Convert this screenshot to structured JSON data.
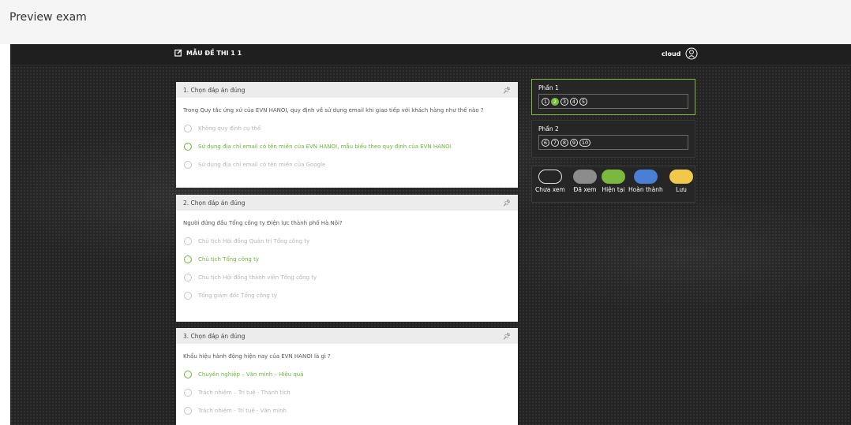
{
  "page": {
    "title": "Preview exam"
  },
  "exam": {
    "title": "MẪU ĐỀ THI 1 1",
    "user": "cloud"
  },
  "questions": [
    {
      "header": "1. Chọn đáp án đúng",
      "text": "Trong Quy tắc ứng xử của EVN HANOI, quy định về sử dụng email khi giao tiếp với khách hàng như thế nào ?",
      "options": [
        {
          "label": "Không quy định cụ thể",
          "selected": false
        },
        {
          "label": "Sử dụng địa chỉ email có tên miền của EVN HANOI, mẫu biểu theo quy định của EVN HANOI",
          "selected": true
        },
        {
          "label": "Sử dụng địa chỉ email có tên miền của Google",
          "selected": false
        }
      ]
    },
    {
      "header": "2. Chọn đáp án đúng",
      "text": "Người đứng đầu Tổng công ty Điện lực thành phố Hà Nội?",
      "options": [
        {
          "label": "Chủ tịch Hội đồng Quản trị Tổng công ty",
          "selected": false
        },
        {
          "label": "Chủ tịch Tổng công ty",
          "selected": true
        },
        {
          "label": "Chủ tịch Hội đồng thành viên Tổng công ty",
          "selected": false
        },
        {
          "label": "Tổng giám đốc Tổng công ty",
          "selected": false
        }
      ]
    },
    {
      "header": "3. Chọn đáp án đúng",
      "text": "Khẩu hiệu hành động hiện nay của EVN HANOI là gì ?",
      "options": [
        {
          "label": "Chuyên nghiệp – Văn minh – Hiệu quả",
          "selected": true
        },
        {
          "label": "Trách nhiệm – Trí tuệ - Thành tích",
          "selected": false
        },
        {
          "label": "Trách nhiệm - Trí tuệ - Văn minh",
          "selected": false
        }
      ]
    }
  ],
  "sections": [
    {
      "title": "Phần 1",
      "numbers": [
        "1",
        "2",
        "3",
        "4",
        "5"
      ],
      "current": "2"
    },
    {
      "title": "Phần 2",
      "numbers": [
        "6",
        "7",
        "8",
        "9",
        "10"
      ],
      "current": null
    }
  ],
  "legend": [
    {
      "label": "Chưa xem",
      "color": "#262626",
      "border": "#e6e6e6"
    },
    {
      "label": "Đã xem",
      "color": "#8c8c8c",
      "border": "#8c8c8c"
    },
    {
      "label": "Hiện tại",
      "color": "#7ab83f",
      "border": "#7ab83f"
    },
    {
      "label": "Hoàn thành",
      "color": "#4a7fd6",
      "border": "#4a7fd6"
    },
    {
      "label": "Lưu",
      "color": "#f0c94a",
      "border": "#f0c94a"
    }
  ],
  "icons": {
    "edit": "edit-icon",
    "user": "user-icon",
    "pin": "pin-icon"
  }
}
